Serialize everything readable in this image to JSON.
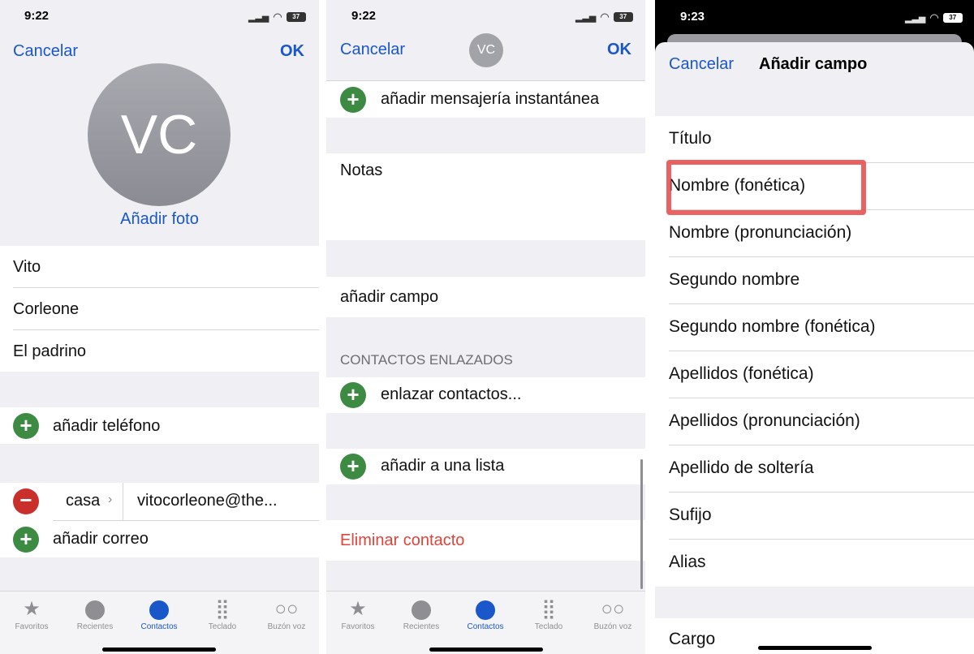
{
  "status": {
    "time1": "9:22",
    "time2": "9:22",
    "time3": "9:23",
    "battery": "37"
  },
  "panel1": {
    "cancel": "Cancelar",
    "ok": "OK",
    "avatar_initials": "VC",
    "add_photo": "Añadir foto",
    "first_name": "Vito",
    "last_name": "Corleone",
    "company": "El padrino",
    "add_phone": "añadir teléfono",
    "email_label": "casa",
    "email_value": "vitocorleone@the...",
    "add_email": "añadir correo"
  },
  "panel2": {
    "cancel": "Cancelar",
    "ok": "OK",
    "avatar_initials": "VC",
    "add_im": "añadir mensajería instantánea",
    "notes": "Notas",
    "add_field": "añadir campo",
    "linked_header": "CONTACTOS ENLAZADOS",
    "link_contacts": "enlazar contactos...",
    "add_to_list": "añadir a una lista",
    "delete_contact": "Eliminar contacto"
  },
  "tabs": [
    {
      "label": "Favoritos",
      "icon": "star-icon",
      "glyph": "★"
    },
    {
      "label": "Recientes",
      "icon": "clock-icon",
      "glyph": "🕘"
    },
    {
      "label": "Contactos",
      "icon": "person-icon",
      "glyph": "●"
    },
    {
      "label": "Teclado",
      "icon": "keypad-icon",
      "glyph": "⣿"
    },
    {
      "label": "Buzón voz",
      "icon": "voicemail-icon",
      "glyph": "○○"
    }
  ],
  "panel3": {
    "cancel": "Cancelar",
    "title": "Añadir campo",
    "fields": [
      "Título",
      "Nombre (fonética)",
      "Nombre (pronunciación)",
      "Segundo nombre",
      "Segundo nombre (fonética)",
      "Apellidos (fonética)",
      "Apellidos (pronunciación)",
      "Apellido de soltería",
      "Sufijo",
      "Alias"
    ],
    "extra_field": "Cargo"
  },
  "colors": {
    "accent": "#1a57c9",
    "add_green": "#3d8b43",
    "delete_red": "#e0433a",
    "highlight": "#e64646"
  }
}
